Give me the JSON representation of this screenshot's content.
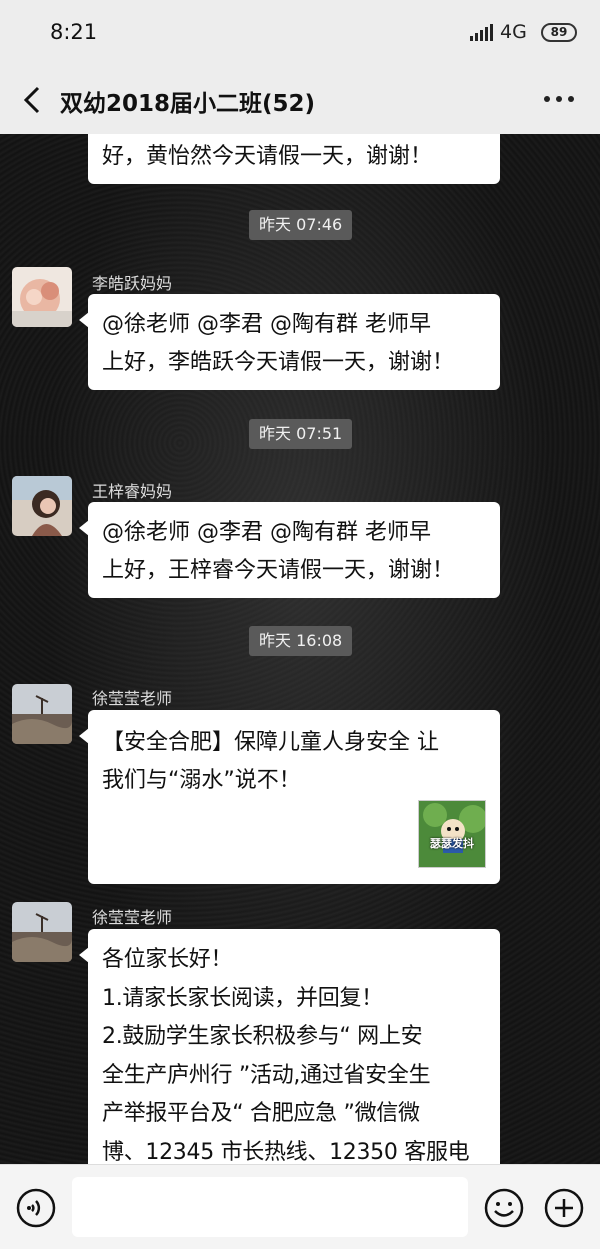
{
  "status_bar": {
    "time": "8:21",
    "network": "4G",
    "battery": "89"
  },
  "header": {
    "title": "双幼2018届小二班(52)"
  },
  "messages": [
    {
      "text": "好，黄怡然今天请假一天，谢谢！"
    },
    {
      "timestamp": "昨天 07:46",
      "sender": "李皓跃妈妈",
      "text": "@徐老师 @李君 @陶有群  老师早\n上好，李皓跃今天请假一天，谢谢！"
    },
    {
      "timestamp": "昨天 07:51",
      "sender": "王梓睿妈妈",
      "text": "@徐老师 @李君 @陶有群  老师早\n上好，王梓睿今天请假一天，谢谢！"
    },
    {
      "timestamp": "昨天 16:08",
      "sender": "徐莹莹老师",
      "text": "【安全合肥】保障儿童人身安全 让\n我们与“溺水”说不！",
      "sticker_text": "瑟瑟发抖"
    },
    {
      "sender": "徐莹莹老师",
      "text": "各位家长好！\n1.请家长家长阅读，并回复！\n2.鼓励学生家长积极参与“ 网上安\n全生产庐州行 ”活动,通过省安全生\n产举报平台及“ 合肥应急 ”微信微\n博、12345 市长热线、12350 客服电"
    }
  ],
  "input": {
    "placeholder": ""
  },
  "icons": {
    "back": "back-arrow-icon",
    "more": "more-dots-icon",
    "voice": "voice-icon",
    "emoji": "emoji-icon",
    "plus": "plus-icon"
  },
  "colors": {
    "bar_bg": "#ededed",
    "bubble_bg": "#ffffff",
    "timestamp_bg": "#5a5a5a"
  }
}
